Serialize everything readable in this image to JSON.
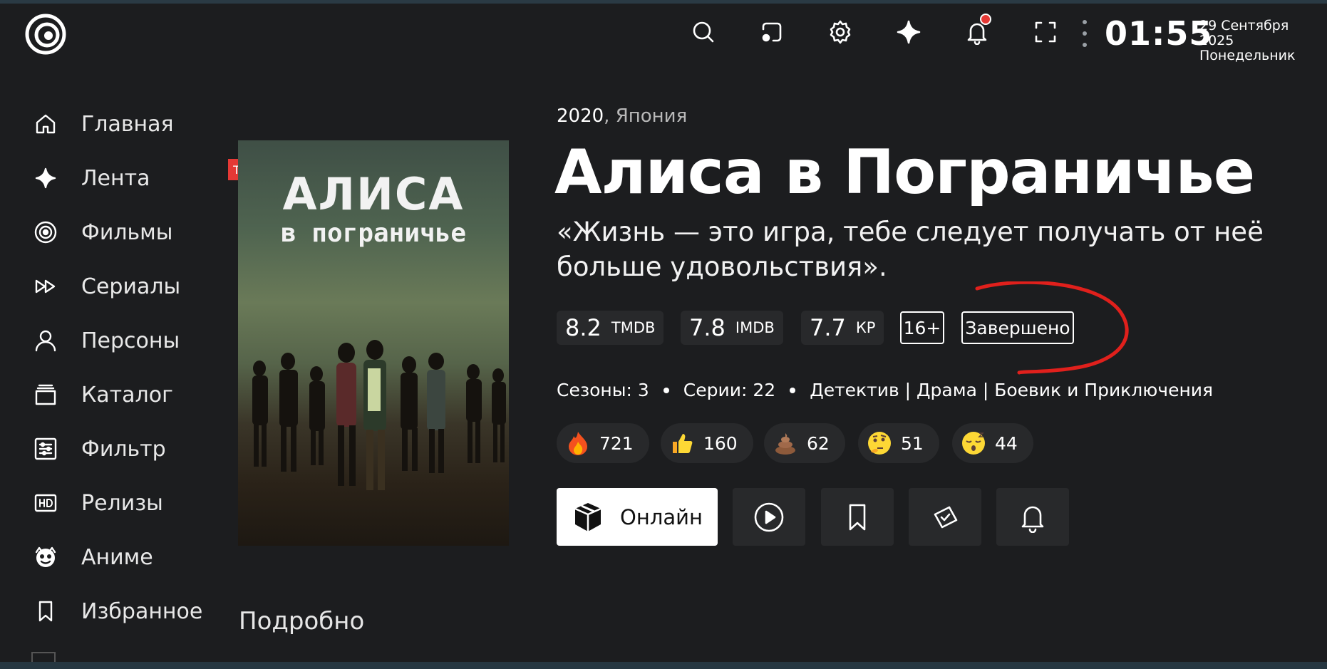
{
  "header": {
    "clock": "01:55",
    "date_line1": "29 Сентября 2025",
    "date_line2": "Понедельник",
    "icons": [
      "search-icon",
      "cast-icon",
      "settings-icon",
      "sparkle-icon",
      "notifications-icon",
      "fullscreen-icon",
      "more-icon"
    ]
  },
  "sidebar": {
    "items": [
      {
        "label": "Главная",
        "icon": "home-icon"
      },
      {
        "label": "Лента",
        "icon": "sparkle-icon"
      },
      {
        "label": "Фильмы",
        "icon": "film-icon"
      },
      {
        "label": "Сериалы",
        "icon": "series-icon"
      },
      {
        "label": "Персоны",
        "icon": "person-icon"
      },
      {
        "label": "Каталог",
        "icon": "catalog-icon"
      },
      {
        "label": "Фильтр",
        "icon": "filter-icon"
      },
      {
        "label": "Релизы",
        "icon": "hd-icon"
      },
      {
        "label": "Аниме",
        "icon": "anime-icon"
      },
      {
        "label": "Избранное",
        "icon": "bookmark-icon"
      }
    ]
  },
  "poster": {
    "badge": "TV",
    "title": "АЛИСА",
    "subtitle": "в пограничье"
  },
  "movie": {
    "year": "2020",
    "country": ", Япония",
    "title": "Алиса в Пограничье",
    "tagline": "«Жизнь — это игра, тебе следует получать от неё больше удовольствия».",
    "ratings": [
      {
        "value": "8.2",
        "source": "TMDB"
      },
      {
        "value": "7.8",
        "source": "IMDB"
      },
      {
        "value": "7.7",
        "source": "КР"
      }
    ],
    "age": "16+",
    "status": "Завершено",
    "seasons": "Сезоны: 3",
    "episodes": "Серии: 22",
    "genres": "Детектив | Драма | Боевик и Приключения",
    "reactions": [
      {
        "icon": "fire-emoji",
        "count": "721"
      },
      {
        "icon": "thumbs-up-emoji",
        "count": "160"
      },
      {
        "icon": "poop-emoji",
        "count": "62"
      },
      {
        "icon": "thinking-emoji",
        "count": "51"
      },
      {
        "icon": "sleepy-emoji",
        "count": "44"
      }
    ],
    "online_label": "Онлайн",
    "annotation_color": "#e0201c"
  },
  "section": {
    "title": "Подробно"
  },
  "colors": {
    "background": "#1c1d1f",
    "card": "#28292b",
    "badge": "#e53935"
  }
}
